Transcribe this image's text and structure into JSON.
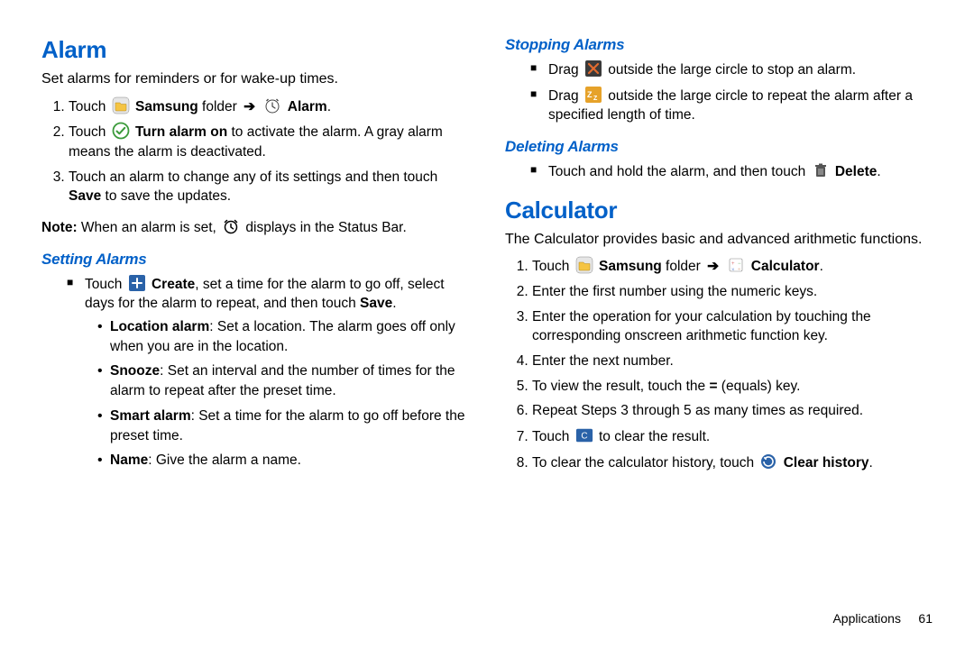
{
  "left": {
    "alarm_title": "Alarm",
    "alarm_lead": "Set alarms for reminders or for wake-up times.",
    "alarm_steps": {
      "s1_pre": "Touch ",
      "s1_b1": "Samsung",
      "s1_mid": " folder ",
      "s1_b2": "Alarm",
      "s1_post": ".",
      "s2_pre": "Touch ",
      "s2_b": "Turn alarm on",
      "s2_post": " to activate the alarm. A gray alarm means the alarm is deactivated.",
      "s3_pre": "Touch an alarm to change any of its settings and then touch ",
      "s3_b": "Save",
      "s3_post": " to save the updates."
    },
    "note_pre": "Note:",
    "note_mid": " When an alarm is set, ",
    "note_post": " displays in the Status Bar.",
    "setting_title": "Setting Alarms",
    "setting_main_pre": "Touch ",
    "setting_main_b1": "Create",
    "setting_main_mid": ", set a time for the alarm to go off, select days for the alarm to repeat, and then touch ",
    "setting_main_b2": "Save",
    "setting_main_post": ".",
    "opts": {
      "loc_b": "Location alarm",
      "loc_t": ": Set a location. The alarm goes off only when you are in the location.",
      "sn_b": "Snooze",
      "sn_t": ": Set an interval and the number of times for the alarm to repeat after the preset time.",
      "sm_b": "Smart alarm",
      "sm_t": ": Set a time for the alarm to go off before the preset time.",
      "nm_b": "Name",
      "nm_t": ": Give the alarm a name."
    }
  },
  "right": {
    "stopping_title": "Stopping Alarms",
    "stop1_pre": "Drag ",
    "stop1_post": " outside the large circle to stop an alarm.",
    "stop2_pre": "Drag ",
    "stop2_post": " outside the large circle to repeat the alarm after a specified length of time.",
    "deleting_title": "Deleting Alarms",
    "del_pre": "Touch and hold the alarm, and then touch ",
    "del_b": "Delete",
    "del_post": ".",
    "calc_title": "Calculator",
    "calc_lead": "The Calculator provides basic and advanced arithmetic functions.",
    "calc_steps": {
      "s1_pre": "Touch ",
      "s1_b1": "Samsung",
      "s1_mid": " folder ",
      "s1_b2": "Calculator",
      "s1_post": ".",
      "s2": "Enter the first number using the numeric keys.",
      "s3": "Enter the operation for your calculation by touching the corresponding onscreen arithmetic function key.",
      "s4": "Enter the next number.",
      "s5_pre": "To view the result, touch the ",
      "s5_b": "=",
      "s5_post": " (equals) key.",
      "s6": "Repeat Steps 3 through 5 as many times as required.",
      "s7_pre": "Touch ",
      "s7_post": " to clear the result.",
      "s8_pre": "To clear the calculator history, touch ",
      "s8_b": "Clear history",
      "s8_post": "."
    }
  },
  "footer": {
    "section": "Applications",
    "page": "61"
  }
}
